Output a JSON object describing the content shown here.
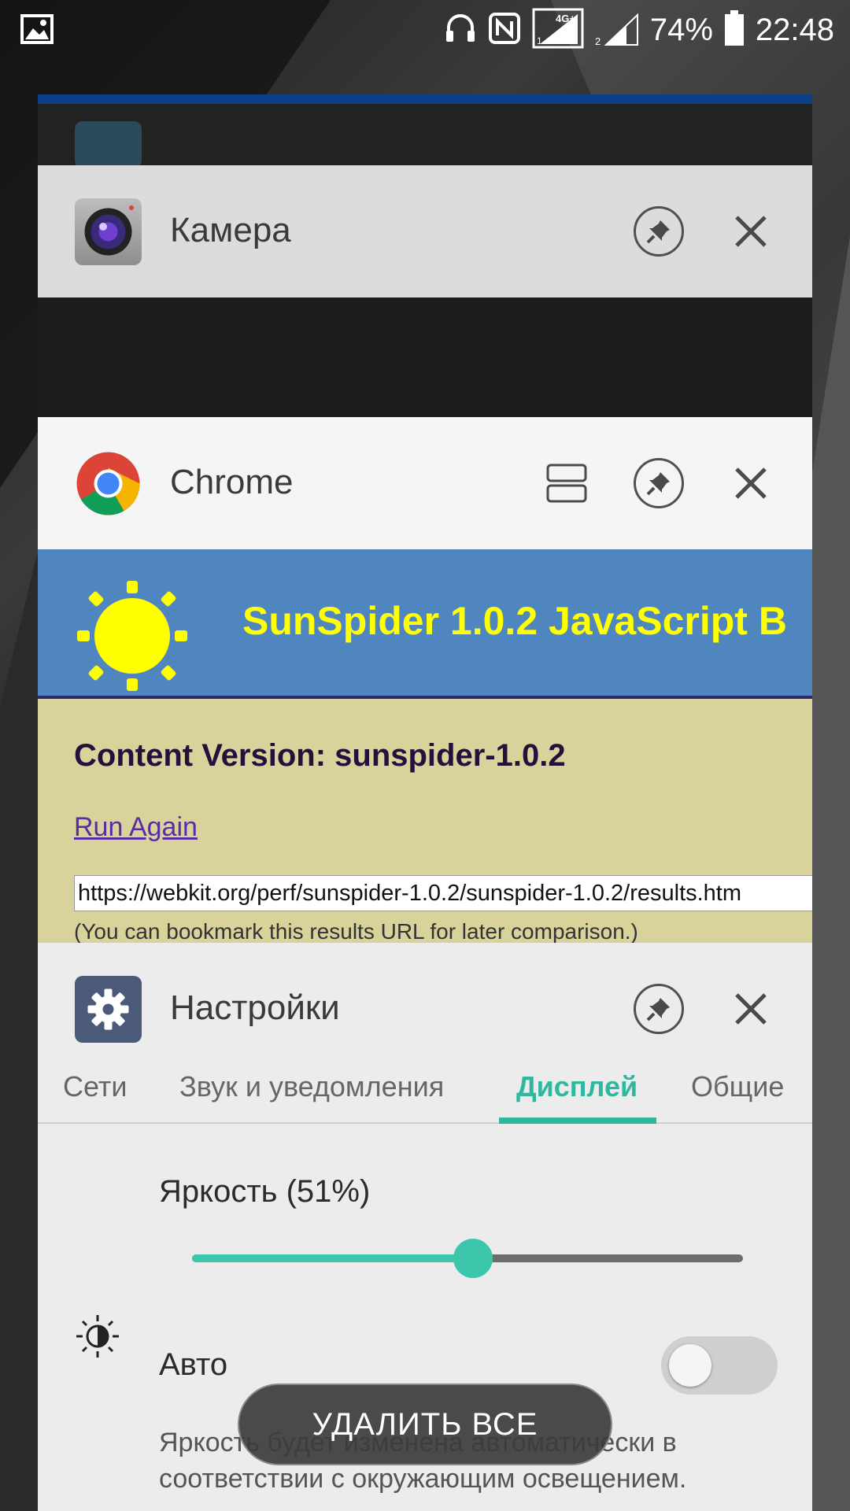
{
  "status_bar": {
    "network_label": "4G+",
    "sim1": "1",
    "sim2": "2",
    "battery": "74%",
    "time": "22:48"
  },
  "recents": [
    {
      "app": "Камера",
      "icon": "camera-icon"
    },
    {
      "app": "Chrome",
      "icon": "chrome-icon",
      "page": {
        "banner_title": "SunSpider 1.0.2 JavaScript B",
        "heading": "Content Version: sunspider-1.0.2",
        "link": "Run Again",
        "url": "https://webkit.org/perf/sunspider-1.0.2/sunspider-1.0.2/results.htm",
        "note": "(You can bookmark this results URL for later comparison.)"
      }
    },
    {
      "app": "Настройки",
      "icon": "settings-gear-icon",
      "tabs": [
        "Сети",
        "Звук и уведомления",
        "Дисплей",
        "Общие"
      ],
      "active_tab": "Дисплей",
      "brightness_label": "Яркость (51%)",
      "brightness_value": 0.51,
      "auto_label": "Авто",
      "auto_enabled": false,
      "auto_description": "Яркость будет изменена автоматически в соответствии с окружающим освещением."
    }
  ],
  "clear_all_label": "УДАЛИТЬ ВСЕ",
  "colors": {
    "accent": "#2fb7a0",
    "sunspider_banner": "#4f86bf",
    "sunspider_title": "#ffff00",
    "page_bg": "#d8d39b"
  }
}
